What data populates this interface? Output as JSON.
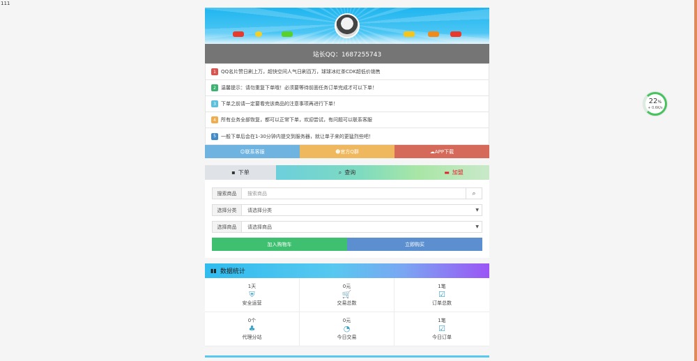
{
  "corner_text": "111",
  "owner_label": "站长QQ：1687255743",
  "speed": {
    "percent": "22",
    "unit": "%",
    "rate": "+ 0.6K/s"
  },
  "notices": [
    {
      "num": "1",
      "color": "#d9534f",
      "text": "QQ名片赞日刷上万，超快空间人气日刷百万，球球冰红茶CDK超低价销售"
    },
    {
      "num": "2",
      "color": "#3cb371",
      "text": "温馨提示：请勿重复下单哦！必须要等待前面任务订单完成才可以下单！"
    },
    {
      "num": "3",
      "color": "#5bc0de",
      "text": "下单之前请一定要看完该商品的注意事项再进行下单！"
    },
    {
      "num": "4",
      "color": "#f0ad4e",
      "text": "所有业务全部恢复，都可以正常下单，欢迎尝试，有问题可以联系客服"
    },
    {
      "num": "5",
      "color": "#428bca",
      "text": "一般下单后会在1-30分钟内提交到服务器，就让单子来的更猛烈些吧！"
    }
  ],
  "links": [
    {
      "icon": "☺",
      "label": "联系客服",
      "color": "#6fb3e0"
    },
    {
      "icon": "☻",
      "label": "官方Q群",
      "color": "#f0b85e"
    },
    {
      "icon": "☁",
      "label": "APP下载",
      "color": "#d66a5a"
    }
  ],
  "tabs": [
    {
      "icon": "▪",
      "label": "下单"
    },
    {
      "icon": "⌕",
      "label": "查询"
    },
    {
      "icon": "▬",
      "label": "加盟"
    }
  ],
  "form": {
    "search_label": "搜索商品",
    "search_placeholder": "搜索商品",
    "category_label": "选择分类",
    "category_value": "请选择分类",
    "product_label": "选择商品",
    "product_value": "请选择商品",
    "add_cart": "加入购物车",
    "buy_now": "立即购买"
  },
  "stats_title": "数据统计",
  "stats": [
    {
      "value": "1天",
      "icon": "⛨",
      "label": "安全运营"
    },
    {
      "value": "0元",
      "icon": "🛒",
      "label": "交易总数"
    },
    {
      "value": "1笔",
      "icon": "☑",
      "label": "订单总数"
    },
    {
      "value": "0个",
      "icon": "♣",
      "label": "代理分站"
    },
    {
      "value": "0元",
      "icon": "◔",
      "label": "今日交易"
    },
    {
      "value": "1笔",
      "icon": "☑",
      "label": "今日订单"
    }
  ],
  "colors": {
    "add_cart": "#3fbf70",
    "buy_now": "#5b8fd0",
    "tab_join": "#e2222d"
  }
}
